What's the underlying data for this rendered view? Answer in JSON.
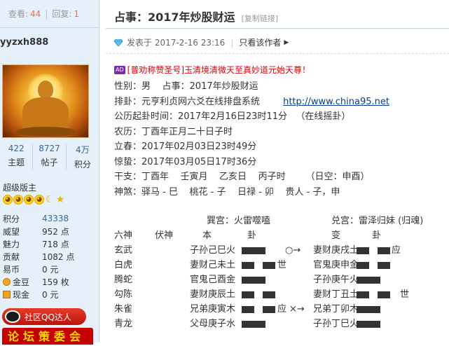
{
  "thread_stats": {
    "views_label": "查看:",
    "views": "44",
    "replies_label": "回复:",
    "replies": "1"
  },
  "user": {
    "username": "yyzxh888",
    "stats": [
      {
        "value": "422",
        "label": "主题"
      },
      {
        "value": "8727",
        "label": "帖子"
      },
      {
        "value": "4万",
        "label": "积分"
      }
    ],
    "group": "超级版主",
    "info": [
      {
        "key": "积分",
        "value": "43338",
        "icon": ""
      },
      {
        "key": "威望",
        "value": "952 点",
        "icon": ""
      },
      {
        "key": "魅力",
        "value": "718 点",
        "icon": ""
      },
      {
        "key": "贡献",
        "value": "1082 点",
        "icon": ""
      },
      {
        "key": "易币",
        "value": "0 元",
        "icon": ""
      },
      {
        "key": "金豆",
        "value": "159 枚",
        "icon": "coin-icon"
      },
      {
        "key": "现金",
        "value": "0 元",
        "icon": "cash-icon"
      }
    ],
    "qq_badge": "社区QQ达人",
    "forum_badge": "论坛策委会"
  },
  "post": {
    "title": "占事：2017年炒股财运",
    "copy_link": "[复制链接]",
    "posted_at": "发表于 2017-2-16 23:16",
    "only_author": "只看该作者",
    "ad": {
      "tag": "AD",
      "bracket": "[普劝称赞圣号]",
      "text": "玉清境清微天至真妙道元始天尊！"
    },
    "lines": [
      "性别：男    占事：2017年炒股财运",
      "排卦：元亨利贞网六爻在线排盘系统",
      "公历起卦时间：2017年2月16日23时11分   （在线摇卦）",
      "农历：丁酉年正月二十日子时",
      "立春：2017年02月03日23时49分",
      "惊蛰：2017年03月05日17时36分",
      "干支：丁酉年    壬寅月    乙亥日    丙子时       （日空：申酉）",
      "神煞：驿马 - 巳    桃花 - 子    日禄 - 卯    贵人 - 子，申"
    ],
    "link": "http://www.china95.net",
    "hexagram": {
      "palace_left": "巽宫：火雷噬嗑",
      "palace_right": "兑宫：雷泽归妹 (归魂)",
      "headers": [
        "六神",
        "伏神",
        "本",
        "卦",
        "变",
        "卦"
      ],
      "rows": [
        {
          "god": "玄武",
          "fu": "",
          "yao": "子孙己巳火",
          "mark": "",
          "change": "○→",
          "bian": "妻财庚戌土",
          "bmark": "应"
        },
        {
          "god": "白虎",
          "fu": "",
          "yao": "妻财己未土",
          "mark": "世",
          "change": "",
          "bian": "官鬼庚申金",
          "bmark": ""
        },
        {
          "god": "腾蛇",
          "fu": "",
          "yao": "官鬼己酉金",
          "mark": "",
          "change": "",
          "bian": "子孙庚午火",
          "bmark": ""
        },
        {
          "god": "勾陈",
          "fu": "",
          "yao": "妻财庚辰土",
          "mark": "",
          "change": "",
          "bian": "妻财丁丑土",
          "bmark": "世"
        },
        {
          "god": "朱雀",
          "fu": "",
          "yao": "兄弟庚寅木",
          "mark": "应",
          "change": "×→",
          "bian": "兄弟丁卯木",
          "bmark": ""
        },
        {
          "god": "青龙",
          "fu": "",
          "yao": "父母庚子水",
          "mark": "",
          "change": "",
          "bian": "子孙丁巳火",
          "bmark": ""
        }
      ]
    }
  }
}
